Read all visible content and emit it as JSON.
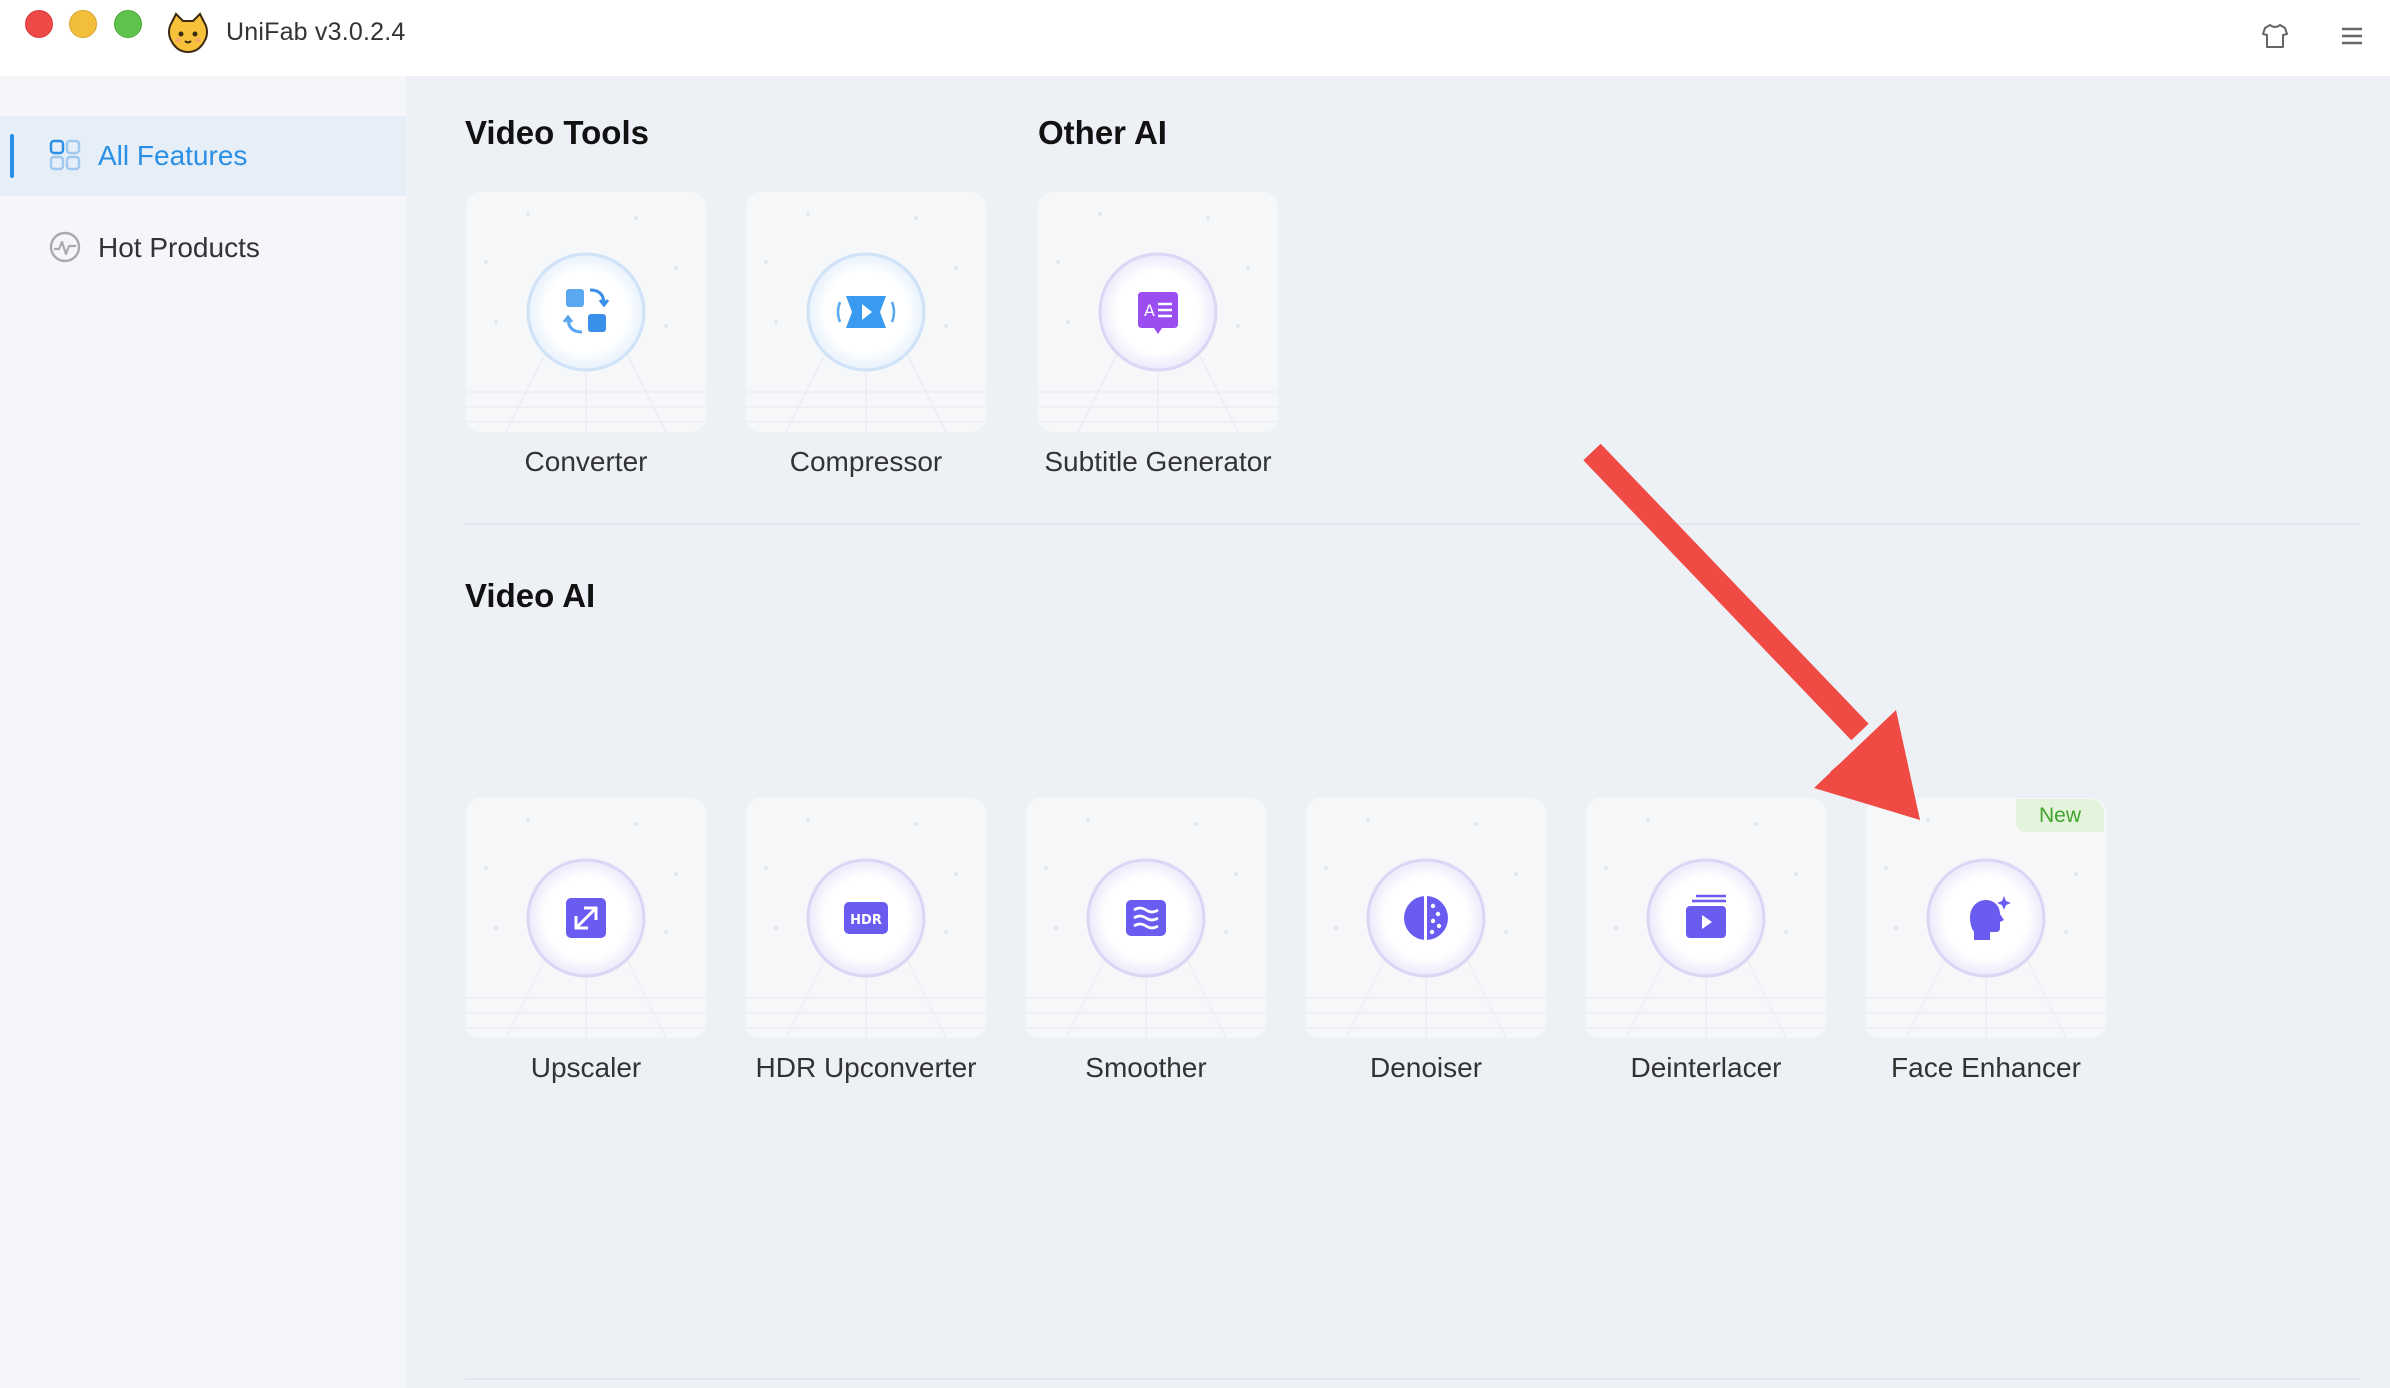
{
  "window": {
    "title": "UniFab v3.0.2.4",
    "traffic_lights": [
      "close",
      "minimize",
      "maximize"
    ],
    "toolbar_icons": [
      "shirt-icon",
      "menu-icon"
    ]
  },
  "sidebar": {
    "items": [
      {
        "label": "All Features",
        "icon": "grid-icon",
        "active": true
      },
      {
        "label": "Hot Products",
        "icon": "activity-icon",
        "active": false
      }
    ]
  },
  "sections": {
    "video_tools": {
      "title": "Video Tools",
      "cards": [
        {
          "label": "Converter",
          "icon": "convert-icon"
        },
        {
          "label": "Compressor",
          "icon": "compress-icon"
        }
      ]
    },
    "other_ai": {
      "title": "Other AI",
      "cards": [
        {
          "label": "Subtitle Generator",
          "icon": "subtitle-icon"
        }
      ]
    },
    "video_ai": {
      "title": "Video AI",
      "cards": [
        {
          "label": "Upscaler",
          "icon": "upscale-icon"
        },
        {
          "label": "HDR Upconverter",
          "icon": "hdr-icon",
          "icon_text": "HDR"
        },
        {
          "label": "Smoother",
          "icon": "wave-icon"
        },
        {
          "label": "Denoiser",
          "icon": "denoise-icon"
        },
        {
          "label": "Deinterlacer",
          "icon": "deinterlace-icon"
        },
        {
          "label": "Face Enhancer",
          "icon": "face-icon",
          "badge": "New"
        }
      ]
    }
  },
  "colors": {
    "accent": "#2b8fe6",
    "blue_icon": "#3a9af0",
    "purple_icon": "#6a5cf0",
    "subtitle_purple": "#9a4ef2",
    "annotation_arrow": "#f04a45",
    "badge_green": "#3fa52c"
  }
}
